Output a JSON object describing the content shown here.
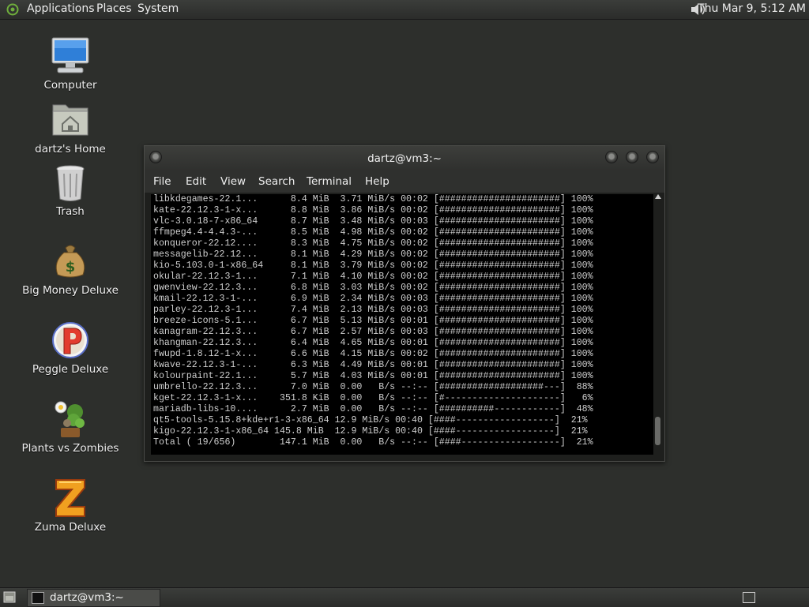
{
  "top_panel": {
    "menus": [
      "Applications",
      "Places",
      "System"
    ],
    "clock": "Thu Mar  9,  5:12 AM"
  },
  "desktop_icons": [
    {
      "label": "Computer",
      "icon": "computer-icon"
    },
    {
      "label": "dartz's Home",
      "icon": "home-folder-icon"
    },
    {
      "label": "Trash",
      "icon": "trash-icon"
    },
    {
      "label": "Big Money Deluxe",
      "icon": "money-bag-icon"
    },
    {
      "label": "Peggle Deluxe",
      "icon": "peggle-icon"
    },
    {
      "label": "Plants vs Zombies",
      "icon": "plants-vs-zombies-icon"
    },
    {
      "label": "Zuma Deluxe",
      "icon": "zuma-icon"
    }
  ],
  "terminal": {
    "title": "dartz@vm3:~",
    "menu": [
      "File",
      "Edit",
      "View",
      "Search",
      "Terminal",
      "Help"
    ],
    "lines": [
      "libkdegames-22.1...      8.4 MiB  3.71 MiB/s 00:02 [######################] 100%",
      "kate-22.12.3-1-x...      8.8 MiB  3.86 MiB/s 00:02 [######################] 100%",
      "vlc-3.0.18-7-x86_64      8.7 MiB  3.48 MiB/s 00:03 [######################] 100%",
      "ffmpeg4.4-4.4.3-...      8.5 MiB  4.98 MiB/s 00:02 [######################] 100%",
      "konqueror-22.12....      8.3 MiB  4.75 MiB/s 00:02 [######################] 100%",
      "messagelib-22.12...      8.1 MiB  4.29 MiB/s 00:02 [######################] 100%",
      "kio-5.103.0-1-x86_64     8.1 MiB  3.79 MiB/s 00:02 [######################] 100%",
      "okular-22.12.3-1...      7.1 MiB  4.10 MiB/s 00:02 [######################] 100%",
      "gwenview-22.12.3...      6.8 MiB  3.03 MiB/s 00:02 [######################] 100%",
      "kmail-22.12.3-1-...      6.9 MiB  2.34 MiB/s 00:03 [######################] 100%",
      "parley-22.12.3-1...      7.4 MiB  2.13 MiB/s 00:03 [######################] 100%",
      "breeze-icons-5.1...      6.7 MiB  5.13 MiB/s 00:01 [######################] 100%",
      "kanagram-22.12.3...      6.7 MiB  2.57 MiB/s 00:03 [######################] 100%",
      "khangman-22.12.3...      6.4 MiB  4.65 MiB/s 00:01 [######################] 100%",
      "fwupd-1.8.12-1-x...      6.6 MiB  4.15 MiB/s 00:02 [######################] 100%",
      "kwave-22.12.3-1-...      6.3 MiB  4.49 MiB/s 00:01 [######################] 100%",
      "kolourpaint-22.1...      5.7 MiB  4.03 MiB/s 00:01 [######################] 100%",
      "umbrello-22.12.3...      7.0 MiB  0.00   B/s --:-- [###################---]  88%",
      "kget-22.12.3-1-x...    351.8 KiB  0.00   B/s --:-- [#---------------------]   6%",
      "mariadb-libs-10....      2.7 MiB  0.00   B/s --:-- [##########------------]  48%",
      "qt5-tools-5.15.8+kde+r1-3-x86_64 12.9 MiB/s 00:40 [####------------------]  21%",
      "kigo-22.12.3-1-x86_64 145.8 MiB  12.9 MiB/s 00:40 [####------------------]  21%",
      "Total ( 19/656)        147.1 MiB  0.00   B/s --:-- [####------------------]  21%"
    ]
  },
  "bottom_panel": {
    "task_label": "dartz@vm3:~"
  }
}
